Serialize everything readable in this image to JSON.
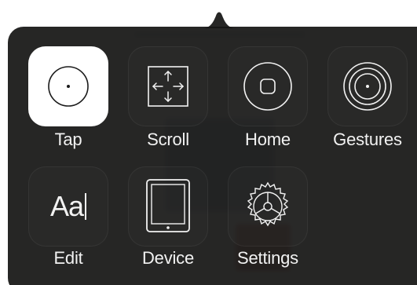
{
  "colors": {
    "panel": "#161614",
    "active_tile": "#ffffff",
    "icon_light": "#f2f2f2",
    "icon_dark": "#1a1a1a"
  },
  "menu": {
    "items": [
      {
        "label": "Tap",
        "icon": "tap-circle-icon",
        "active": true
      },
      {
        "label": "Scroll",
        "icon": "scroll-arrows-icon",
        "active": false
      },
      {
        "label": "Home",
        "icon": "home-button-icon",
        "active": false
      },
      {
        "label": "Gestures",
        "icon": "gestures-concentric-circles-icon",
        "active": false
      },
      {
        "label": "Edit",
        "icon": "text-edit-icon",
        "active": false
      },
      {
        "label": "Device",
        "icon": "tablet-device-icon",
        "active": false
      },
      {
        "label": "Settings",
        "icon": "gear-icon",
        "active": false
      }
    ],
    "edit_glyph": "Aa"
  }
}
